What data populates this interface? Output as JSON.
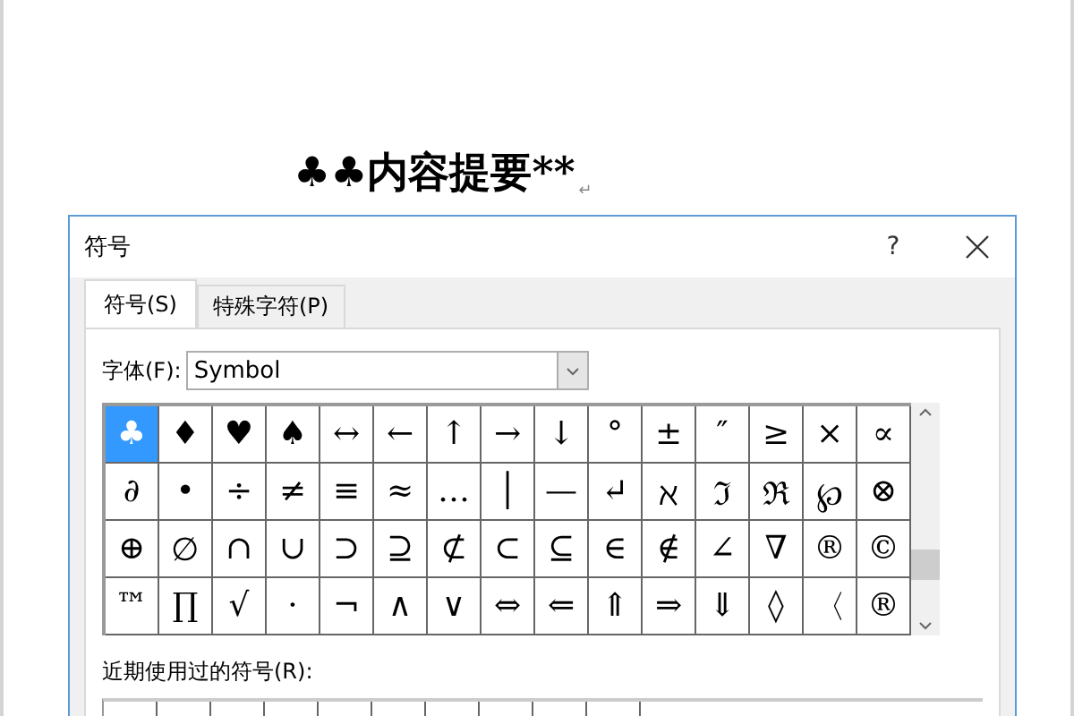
{
  "document": {
    "heading": "♣♣内容提要**",
    "paragraph_mark": "↵"
  },
  "dialog": {
    "title": "符号",
    "help": "?",
    "tabs": [
      {
        "label": "符号(S)",
        "selected": true
      },
      {
        "label": "特殊字符(P)",
        "selected": false
      }
    ],
    "font": {
      "label": "字体(F):",
      "value": "Symbol"
    },
    "symbols": [
      [
        {
          "char": "♣",
          "selected": true
        },
        {
          "char": "♦",
          "selected": false
        },
        {
          "char": "♥",
          "selected": false
        },
        {
          "char": "♠",
          "selected": false
        },
        {
          "char": "↔",
          "selected": false
        },
        {
          "char": "←",
          "selected": false
        },
        {
          "char": "↑",
          "selected": false
        },
        {
          "char": "→",
          "selected": false
        },
        {
          "char": "↓",
          "selected": false
        },
        {
          "char": "°",
          "selected": false
        },
        {
          "char": "±",
          "selected": false
        },
        {
          "char": "″",
          "selected": false
        },
        {
          "char": "≥",
          "selected": false
        },
        {
          "char": "×",
          "selected": false
        },
        {
          "char": "∝",
          "selected": false
        }
      ],
      [
        {
          "char": "∂",
          "selected": false
        },
        {
          "char": "•",
          "selected": false
        },
        {
          "char": "÷",
          "selected": false
        },
        {
          "char": "≠",
          "selected": false
        },
        {
          "char": "≡",
          "selected": false
        },
        {
          "char": "≈",
          "selected": false
        },
        {
          "char": "…",
          "selected": false
        },
        {
          "char": "│",
          "selected": false
        },
        {
          "char": "—",
          "selected": false
        },
        {
          "char": "↵",
          "selected": false
        },
        {
          "char": "ℵ",
          "selected": false
        },
        {
          "char": "ℑ",
          "selected": false
        },
        {
          "char": "ℜ",
          "selected": false
        },
        {
          "char": "℘",
          "selected": false
        },
        {
          "char": "⊗",
          "selected": false
        }
      ],
      [
        {
          "char": "⊕",
          "selected": false
        },
        {
          "char": "∅",
          "selected": false
        },
        {
          "char": "∩",
          "selected": false
        },
        {
          "char": "∪",
          "selected": false
        },
        {
          "char": "⊃",
          "selected": false
        },
        {
          "char": "⊇",
          "selected": false
        },
        {
          "char": "⊄",
          "selected": false
        },
        {
          "char": "⊂",
          "selected": false
        },
        {
          "char": "⊆",
          "selected": false
        },
        {
          "char": "∈",
          "selected": false
        },
        {
          "char": "∉",
          "selected": false
        },
        {
          "char": "∠",
          "selected": false
        },
        {
          "char": "∇",
          "selected": false
        },
        {
          "char": "®",
          "selected": false
        },
        {
          "char": "©",
          "selected": false
        }
      ],
      [
        {
          "char": "™",
          "selected": false
        },
        {
          "char": "∏",
          "selected": false
        },
        {
          "char": "√",
          "selected": false
        },
        {
          "char": "·",
          "selected": false
        },
        {
          "char": "¬",
          "selected": false
        },
        {
          "char": "∧",
          "selected": false
        },
        {
          "char": "∨",
          "selected": false
        },
        {
          "char": "⇔",
          "selected": false
        },
        {
          "char": "⇐",
          "selected": false
        },
        {
          "char": "⇑",
          "selected": false
        },
        {
          "char": "⇒",
          "selected": false
        },
        {
          "char": "⇓",
          "selected": false
        },
        {
          "char": "◊",
          "selected": false
        },
        {
          "char": "〈",
          "selected": false
        },
        {
          "char": "®",
          "selected": false
        }
      ]
    ],
    "recent_label": "近期使用过的符号(R):"
  }
}
